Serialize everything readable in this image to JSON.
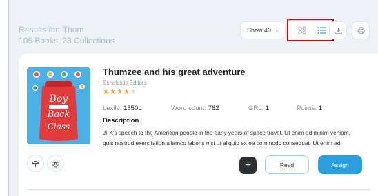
{
  "header": {
    "results_label": "Results for: Thum",
    "results_counts": "105 Books, 23 Collections",
    "show_select": "Show 40"
  },
  "toolbar": {
    "grid_view_icon": "grid-icon",
    "list_view_icon": "list-icon",
    "download_icon": "download-icon",
    "print_icon": "print-icon",
    "highlight_color": "#e00000",
    "active_color": "#2a9fe0"
  },
  "book": {
    "title": "Thumzee and his great adventure",
    "publisher": "Scholastic Editors",
    "rating": 4,
    "rating_max": 5,
    "cover_title": "The Boy at the Back of the Class",
    "lexile_label": "Lexile:",
    "lexile_value": "1550L",
    "wordcount_label": "Word count:",
    "wordcount_value": "782",
    "grl_label": "GRL:",
    "grl_value": "1",
    "points_label": "Points:",
    "points_value": "1",
    "description_heading": "Description",
    "description_line1": "JFK's speech to the American people in the early years of space travel. Ut enim ad minim veniam,",
    "description_line2": "quis nostrud exercitation ullamco laboris nisi ut aliquip ex ea commodo consequat. Ut enim ad",
    "read_label": "Read",
    "assign_label": "Assign",
    "add_label": "+"
  }
}
